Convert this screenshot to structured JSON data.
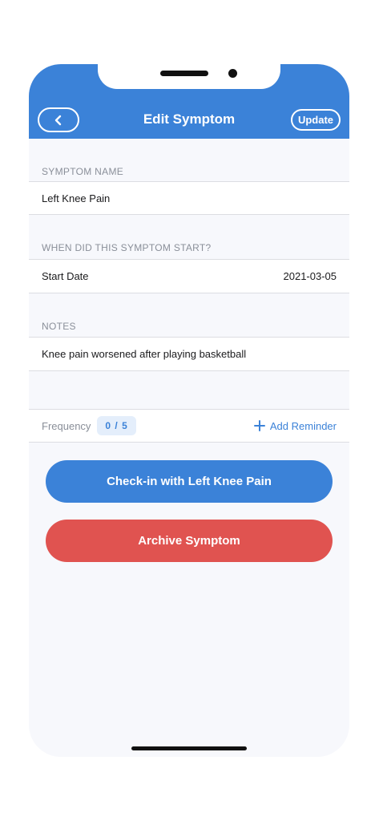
{
  "header": {
    "title": "Edit Symptom",
    "update_label": "Update",
    "color": "#3b82d8"
  },
  "symptom_name": {
    "section_label": "SYMPTOM NAME",
    "value": "Left Knee Pain"
  },
  "start": {
    "section_label": "WHEN DID THIS SYMPTOM START?",
    "field_label": "Start Date",
    "value": "2021-03-05"
  },
  "notes": {
    "section_label": "NOTES",
    "value": "Knee pain worsened after playing basketball"
  },
  "frequency": {
    "label": "Frequency",
    "badge": "0 / 5",
    "add_reminder_label": "Add Reminder"
  },
  "actions": {
    "checkin_label": "Check-in with Left Knee Pain",
    "archive_label": "Archive Symptom",
    "checkin_color": "#3b82d8",
    "archive_color": "#e05350"
  },
  "icons": {
    "back": "chevron-left-icon",
    "add": "plus-icon"
  }
}
